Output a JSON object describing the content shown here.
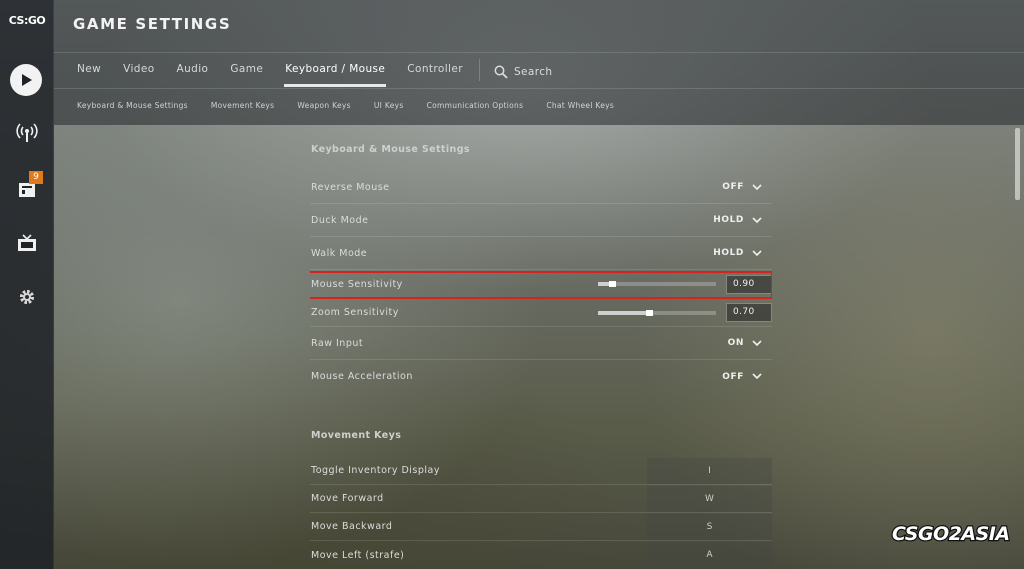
{
  "sidebar": {
    "logo": "CS:GO",
    "badge_count": "9",
    "icons": [
      "play-icon",
      "broadcast-icon",
      "inventory-icon",
      "tv-icon",
      "gear-icon"
    ]
  },
  "header": {
    "title": "GAME SETTINGS",
    "tabs": [
      {
        "label": "New",
        "active": false
      },
      {
        "label": "Video",
        "active": false
      },
      {
        "label": "Audio",
        "active": false
      },
      {
        "label": "Game",
        "active": false
      },
      {
        "label": "Keyboard / Mouse",
        "active": true
      },
      {
        "label": "Controller",
        "active": false
      }
    ],
    "search_label": "Search",
    "subtabs": [
      "Keyboard & Mouse Settings",
      "Movement Keys",
      "Weapon Keys",
      "UI Keys",
      "Communication Options",
      "Chat Wheel Keys"
    ]
  },
  "keyboard_mouse": {
    "section_title": "Keyboard & Mouse Settings",
    "reverse_mouse": {
      "label": "Reverse Mouse",
      "value": "OFF"
    },
    "duck_mode": {
      "label": "Duck Mode",
      "value": "HOLD"
    },
    "walk_mode": {
      "label": "Walk Mode",
      "value": "HOLD"
    },
    "mouse_sensitivity": {
      "label": "Mouse Sensitivity",
      "value": "0.90",
      "slider_fraction": 0.12
    },
    "zoom_sensitivity": {
      "label": "Zoom Sensitivity",
      "value": "0.70",
      "slider_fraction": 0.43
    },
    "raw_input": {
      "label": "Raw Input",
      "value": "ON"
    },
    "mouse_acceleration": {
      "label": "Mouse Acceleration",
      "value": "OFF"
    }
  },
  "movement_keys": {
    "section_title": "Movement Keys",
    "rows": [
      {
        "label": "Toggle Inventory Display",
        "key": "I"
      },
      {
        "label": "Move Forward",
        "key": "W"
      },
      {
        "label": "Move Backward",
        "key": "S"
      },
      {
        "label": "Move Left (strafe)",
        "key": "A"
      }
    ]
  },
  "watermark": "CSGO2ASIA",
  "colors": {
    "highlight": "#d6231e",
    "badge": "#e07a1a"
  }
}
